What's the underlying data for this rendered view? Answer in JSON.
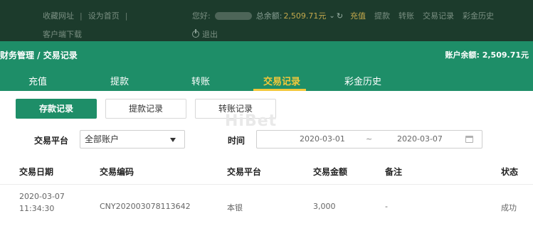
{
  "topbar": {
    "links": [
      "收藏网址",
      "设为首页"
    ],
    "download": "客户端下载",
    "greeting": "您好:",
    "balance_label": "总余额:",
    "balance_value": "2,509.71元",
    "recharge": "充值",
    "nav": [
      "提款",
      "转账",
      "交易记录",
      "彩金历史"
    ],
    "logout": "退出"
  },
  "header": {
    "breadcrumb": "财务管理 / 交易记录",
    "account_label": "账户余额:",
    "account_value": "2,509.71元"
  },
  "tabs": [
    {
      "label": "充值"
    },
    {
      "label": "提款"
    },
    {
      "label": "转账"
    },
    {
      "label": "交易记录"
    },
    {
      "label": "彩金历史"
    }
  ],
  "subtabs": [
    {
      "label": "存款记录"
    },
    {
      "label": "提款记录"
    },
    {
      "label": "转账记录"
    }
  ],
  "watermark": "HiBet",
  "filters": {
    "platform_label": "交易平台",
    "platform_value": "全部账户",
    "time_label": "时间",
    "date_start": "2020-03-01",
    "date_sep": "~",
    "date_end": "2020-03-07"
  },
  "table": {
    "headers": [
      "交易日期",
      "交易编码",
      "交易平台",
      "交易金额",
      "备注",
      "状态"
    ],
    "rows": [
      {
        "date": "2020-03-07",
        "time": "11:34:30",
        "code": "CNY202003078113642",
        "platform": "本银",
        "amount": "3,000",
        "note": "-",
        "status": "成功"
      }
    ]
  },
  "colors": {
    "brand_green": "#1e8e68",
    "dark_top": "#1c3b2c",
    "accent_gold": "#f3c83a"
  }
}
